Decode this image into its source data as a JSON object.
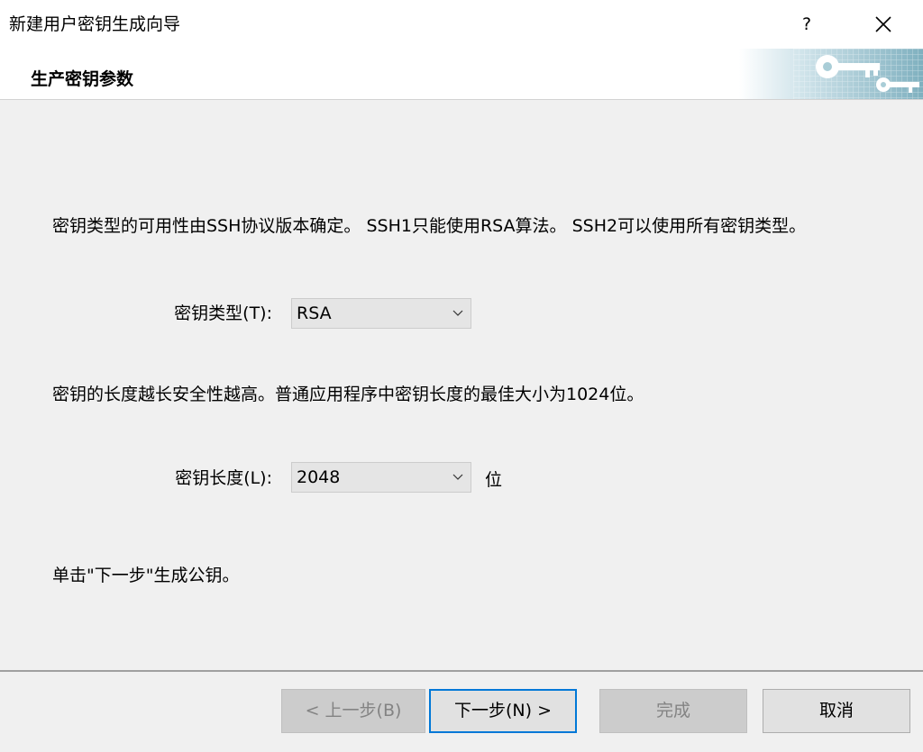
{
  "window": {
    "title": "新建用户密钥生成向导",
    "help_label": "?"
  },
  "header": {
    "title": "生产密钥参数"
  },
  "content": {
    "key_type_description": "密钥类型的可用性由SSH协议版本确定。 SSH1只能使用RSA算法。 SSH2可以使用所有密钥类型。",
    "key_type_label": "密钥类型(T):",
    "key_type_value": "RSA",
    "key_length_description": "密钥的长度越长安全性越高。普通应用程序中密钥长度的最佳大小为1024位。",
    "key_length_label": "密钥长度(L):",
    "key_length_value": "2048",
    "key_length_unit": "位",
    "next_hint": "单击\"下一步\"生成公钥。"
  },
  "buttons": {
    "back": "< 上一步(B)",
    "next": "下一步(N) >",
    "finish": "完成",
    "cancel": "取消"
  },
  "icons": {
    "close": "close-icon",
    "dropdown": "chevron-down-icon",
    "header_graphic": "key-icon"
  },
  "colors": {
    "accent": "#0078d7",
    "disabled_text": "#838383",
    "dialog_background": "#f0f0f0"
  }
}
